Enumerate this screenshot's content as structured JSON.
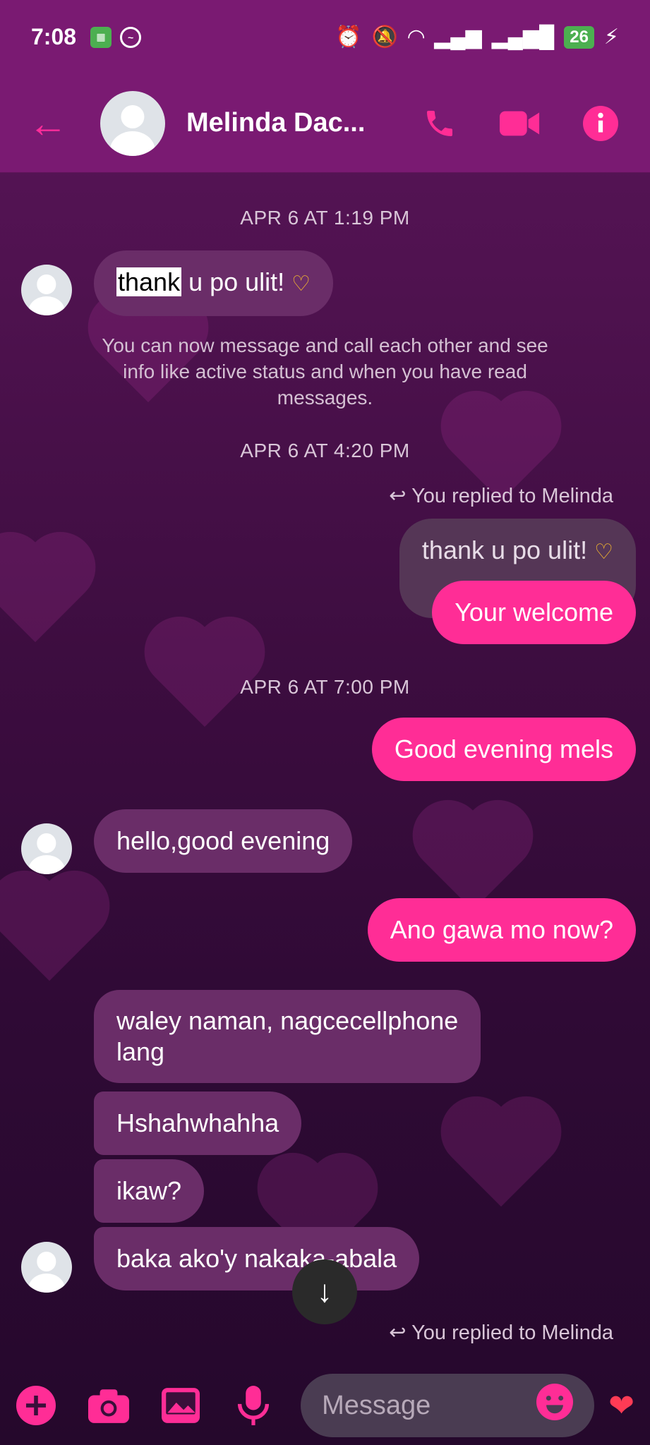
{
  "status_bar": {
    "time": "7:08",
    "battery": "26"
  },
  "header": {
    "contact_name": "Melinda Dac..."
  },
  "messages": {
    "ts1": "APR 6 AT 1:19 PM",
    "m1_highlight": "thank",
    "m1_rest": " u po ulit! ",
    "system_notice": "You can now message and call each other and see info like active status and when you have read messages.",
    "ts2": "APR 6 AT 4:20 PM",
    "replied_label": "You replied to Melinda",
    "quoted": "thank u po ulit! ",
    "m2": "Your welcome",
    "ts3": "APR 6 AT 7:00 PM",
    "m3": "Good evening mels",
    "m4": "hello,good evening",
    "m5": "Ano gawa mo now?",
    "m6_line1": "waley naman, nagcecellphone",
    "m6_line2": "lang",
    "m7": "Hshahwhahha",
    "m8": "ikaw?",
    "m9": "baka ako'y nakaka-abala",
    "replied_label2": "You replied to Melinda"
  },
  "composer": {
    "placeholder": "Message"
  },
  "colors": {
    "accent": "#ff2d96",
    "header": "#7a1a72",
    "incoming": "#6a2d68"
  },
  "icons": [
    "back-arrow-icon",
    "phone-icon",
    "video-icon",
    "info-icon",
    "plus-icon",
    "camera-icon",
    "gallery-icon",
    "mic-icon",
    "emoji-icon",
    "hearts-icon",
    "reply-arrow-icon",
    "scroll-down-icon"
  ]
}
